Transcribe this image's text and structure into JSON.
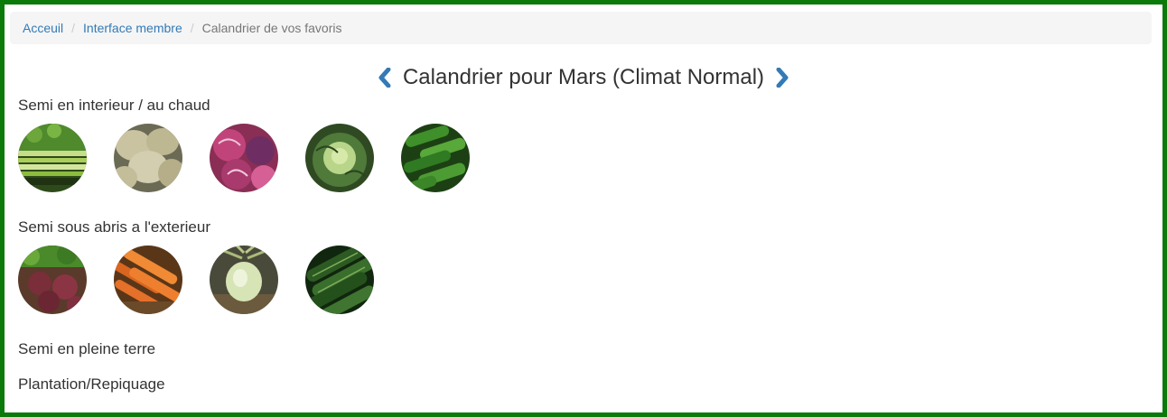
{
  "breadcrumb": {
    "items": [
      "Acceuil",
      "Interface membre"
    ],
    "current": "Calandrier de vos favoris",
    "separator": "/"
  },
  "calendar": {
    "title": "Calandrier pour Mars (Climat Normal)",
    "prev_icon": "chevron-left-icon",
    "next_icon": "chevron-right-icon",
    "accent_color": "#337ab7"
  },
  "sections": [
    {
      "label": "Semi en interieur / au chaud",
      "items": [
        "celery",
        "celeriac",
        "red-cabbage",
        "cabbage",
        "cucumber"
      ]
    },
    {
      "label": "Semi sous abris a l'exterieur",
      "items": [
        "beetroot",
        "carrot",
        "kohlrabi",
        "zucchini"
      ]
    },
    {
      "label": "Semi en pleine terre",
      "items": []
    },
    {
      "label": "Plantation/Repiquage",
      "items": []
    }
  ],
  "frame_color": "#0a7a0a"
}
